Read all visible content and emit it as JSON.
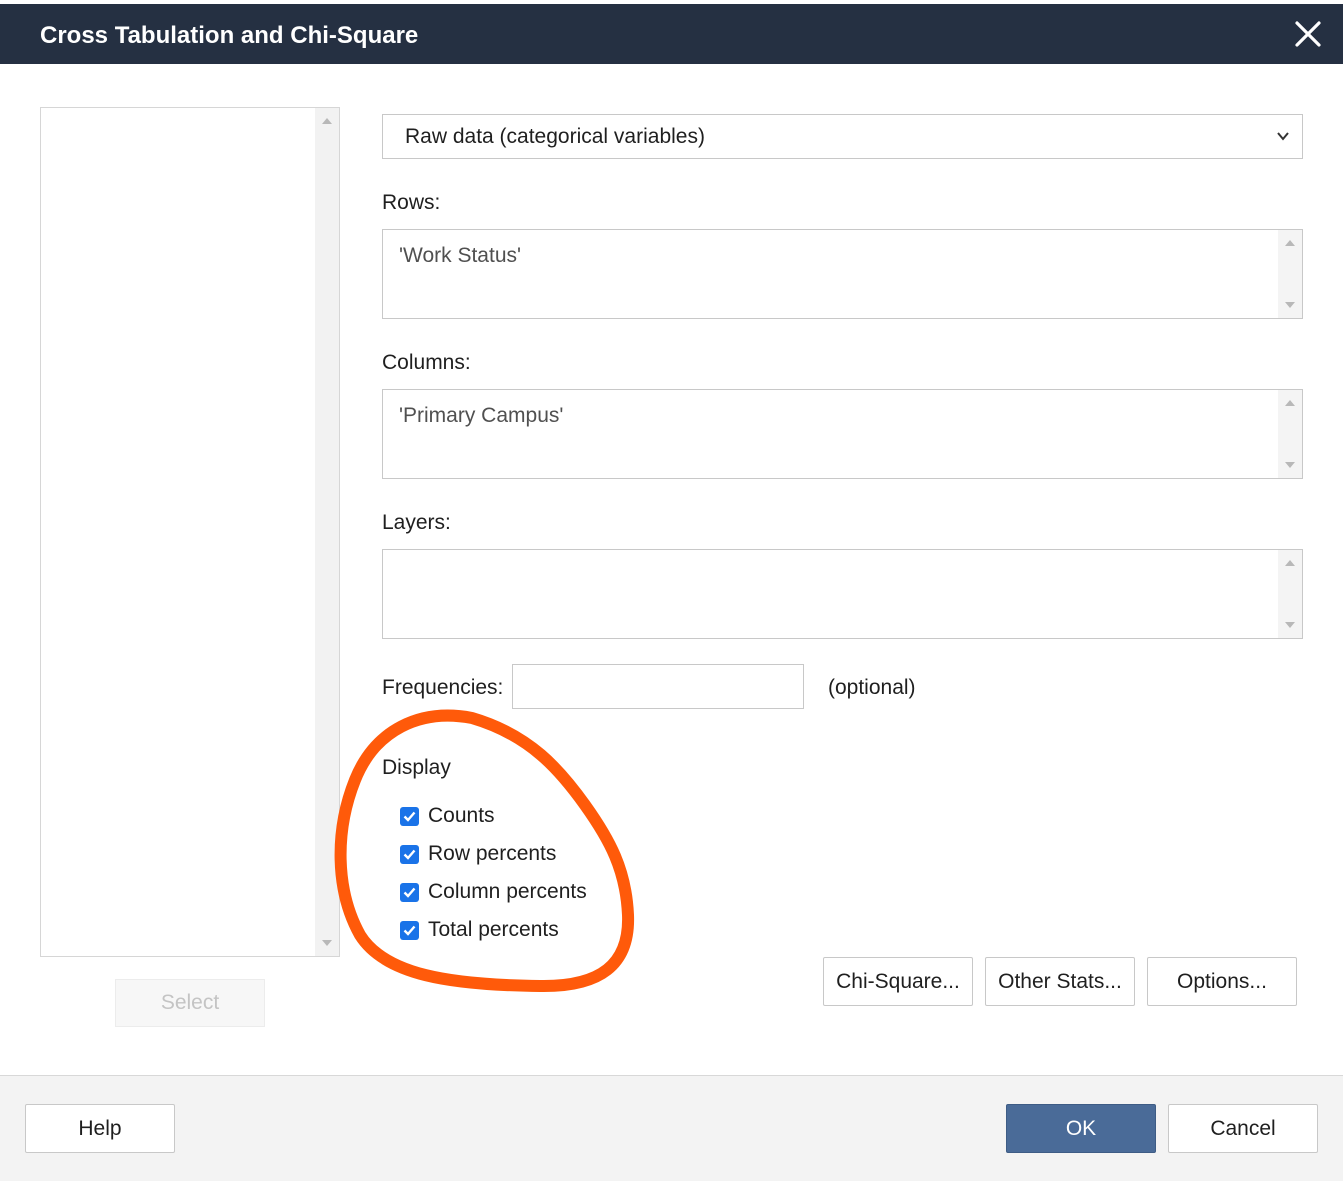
{
  "window": {
    "title": "Cross Tabulation and Chi-Square"
  },
  "variables_list": {
    "select_label": "Select"
  },
  "data_type": {
    "selected": "Raw data (categorical variables)"
  },
  "rows": {
    "label": "Rows:",
    "value": "'Work Status'"
  },
  "columns": {
    "label": "Columns:",
    "value": "'Primary Campus'"
  },
  "layers": {
    "label": "Layers:",
    "value": ""
  },
  "frequencies": {
    "label": "Frequencies:",
    "value": "",
    "hint": "(optional)"
  },
  "display": {
    "label": "Display",
    "options": [
      {
        "label": "Counts",
        "checked": true
      },
      {
        "label": "Row percents",
        "checked": true
      },
      {
        "label": "Column percents",
        "checked": true
      },
      {
        "label": "Total percents",
        "checked": true
      }
    ]
  },
  "action_buttons": {
    "chi_square": "Chi-Square...",
    "other_stats": "Other Stats...",
    "options": "Options..."
  },
  "footer": {
    "help": "Help",
    "ok": "OK",
    "cancel": "Cancel"
  },
  "colors": {
    "titlebar": "#253042",
    "checkbox": "#1a73e8",
    "ok_button": "#4a6b98",
    "annotation_circle": "#ff5a0a"
  },
  "icons": {
    "close": "close-icon",
    "dropdown": "chevron-down-icon",
    "checkbox": "checkmark-icon"
  }
}
